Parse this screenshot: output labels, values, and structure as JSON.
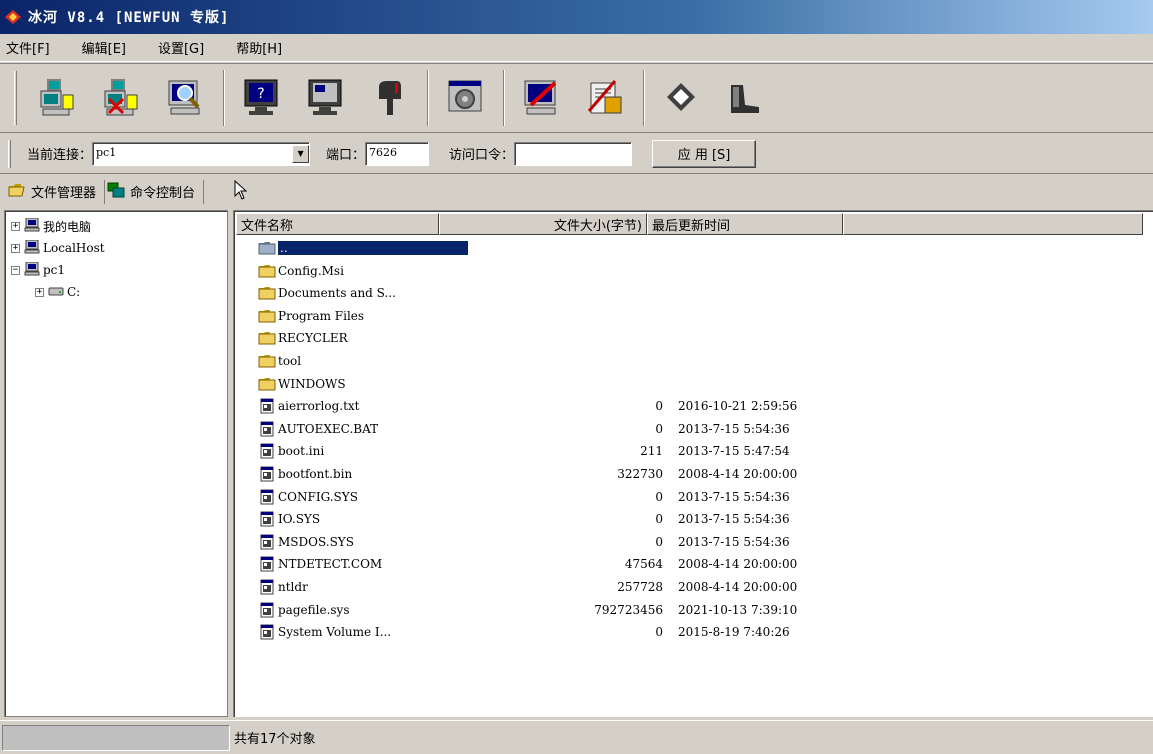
{
  "window": {
    "title": "冰河 V8.4 [NEWFUN 专版]"
  },
  "menu": [
    {
      "label": "文件[F]"
    },
    {
      "label": "编辑[E]"
    },
    {
      "label": "设置[G]"
    },
    {
      "label": "帮助[H]"
    }
  ],
  "toolbar": {
    "buttons": [
      {
        "icon": "add-host-icon"
      },
      {
        "icon": "remove-host-icon"
      },
      {
        "icon": "search-host-icon"
      },
      {
        "icon": "screen-query-icon"
      },
      {
        "icon": "screen-view-icon"
      },
      {
        "icon": "mailbox-icon"
      },
      {
        "icon": "control-panel-icon"
      },
      {
        "icon": "config-client-icon"
      },
      {
        "icon": "config-server-icon"
      },
      {
        "icon": "about-icon"
      },
      {
        "icon": "exit-icon"
      }
    ]
  },
  "connection": {
    "current_label": "当前连接：",
    "current_value": "pc1",
    "port_label": "端口：",
    "port_value": "7626",
    "password_label": "访问口令：",
    "password_value": "",
    "apply_label": "应 用 [S]"
  },
  "tabs": [
    {
      "label": "文件管理器"
    },
    {
      "label": "命令控制台"
    }
  ],
  "tree": {
    "my_computer": "我的电脑",
    "localhost": "LocalHost",
    "pc1": "pc1",
    "drive_c": "C:"
  },
  "filelist": {
    "columns": [
      "文件名称",
      "文件大小(字节)",
      "最后更新时间"
    ],
    "rows": [
      {
        "name": "..",
        "size": "",
        "time": "",
        "type": "parent"
      },
      {
        "name": "Config.Msi",
        "size": "",
        "time": "",
        "type": "folder"
      },
      {
        "name": "Documents and S...",
        "size": "",
        "time": "",
        "type": "folder"
      },
      {
        "name": "Program Files",
        "size": "",
        "time": "",
        "type": "folder"
      },
      {
        "name": "RECYCLER",
        "size": "",
        "time": "",
        "type": "folder"
      },
      {
        "name": "tool",
        "size": "",
        "time": "",
        "type": "folder"
      },
      {
        "name": "WINDOWS",
        "size": "",
        "time": "",
        "type": "folder"
      },
      {
        "name": "aierrorlog.txt",
        "size": "0",
        "time": "2016-10-21 2:59:56",
        "type": "file"
      },
      {
        "name": "AUTOEXEC.BAT",
        "size": "0",
        "time": "2013-7-15 5:54:36",
        "type": "file"
      },
      {
        "name": "boot.ini",
        "size": "211",
        "time": "2013-7-15 5:47:54",
        "type": "file"
      },
      {
        "name": "bootfont.bin",
        "size": "322730",
        "time": "2008-4-14 20:00:00",
        "type": "file"
      },
      {
        "name": "CONFIG.SYS",
        "size": "0",
        "time": "2013-7-15 5:54:36",
        "type": "file"
      },
      {
        "name": "IO.SYS",
        "size": "0",
        "time": "2013-7-15 5:54:36",
        "type": "file"
      },
      {
        "name": "MSDOS.SYS",
        "size": "0",
        "time": "2013-7-15 5:54:36",
        "type": "file"
      },
      {
        "name": "NTDETECT.COM",
        "size": "47564",
        "time": "2008-4-14 20:00:00",
        "type": "file"
      },
      {
        "name": "ntldr",
        "size": "257728",
        "time": "2008-4-14 20:00:00",
        "type": "file"
      },
      {
        "name": "pagefile.sys",
        "size": "792723456",
        "time": "2021-10-13 7:39:10",
        "type": "file"
      },
      {
        "name": "System Volume I...",
        "size": "0",
        "time": "2015-8-19 7:40:26",
        "type": "file"
      }
    ]
  },
  "status": {
    "text": "共有17个对象"
  },
  "colors": {
    "titlebar": "#0a246a",
    "face": "#d4d0c8",
    "selection": "#0a246a"
  }
}
